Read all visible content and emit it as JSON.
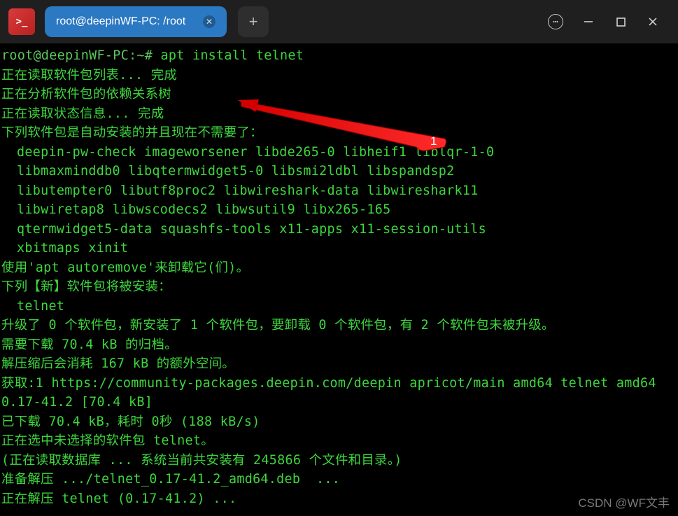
{
  "titlebar": {
    "tab_title": "root@deepinWF-PC: /root",
    "app_icon_glyph": ">_"
  },
  "terminal": {
    "prompt": "root@deepinWF-PC:~# ",
    "command": "apt install telnet",
    "lines": {
      "l1": "正在读取软件包列表... 完成",
      "l2": "正在分析软件包的依赖关系树",
      "l3": "正在读取状态信息... 完成",
      "l4": "下列软件包是自动安装的并且现在不需要了：",
      "pkg1": "deepin-pw-check imageworsener libde265-0 libheif1 liblqr-1-0",
      "pkg2": "libmaxminddb0 libqtermwidget5-0 libsmi2ldbl libspandsp2",
      "pkg3": "libutempter0 libutf8proc2 libwireshark-data libwireshark11",
      "pkg4": "libwiretap8 libwscodecs2 libwsutil9 libx265-165",
      "pkg5": "qtermwidget5-data squashfs-tools x11-apps x11-session-utils",
      "pkg6": "xbitmaps xinit",
      "l5": "使用'apt autoremove'来卸载它(们)。",
      "l6": "下列【新】软件包将被安装：",
      "pkg_new": "telnet",
      "l7": "升级了 0 个软件包，新安装了 1 个软件包，要卸载 0 个软件包，有 2 个软件包未被升级。",
      "l8": "需要下载 70.4 kB 的归档。",
      "l9": "解压缩后会消耗 167 kB 的额外空间。",
      "l10": "获取:1 https://community-packages.deepin.com/deepin apricot/main amd64 telnet amd64 0.17-41.2 [70.4 kB]",
      "l11": "已下载 70.4 kB，耗时 0秒 (188 kB/s)",
      "l12": "正在选中未选择的软件包 telnet。",
      "l13": "(正在读取数据库 ... 系统当前共安装有 245866 个文件和目录。)",
      "l14": "准备解压 .../telnet_0.17-41.2_amd64.deb  ...",
      "l15": "正在解压 telnet (0.17-41.2) ..."
    }
  },
  "callout": {
    "label": "1"
  },
  "watermark": "CSDN @WF文丰"
}
